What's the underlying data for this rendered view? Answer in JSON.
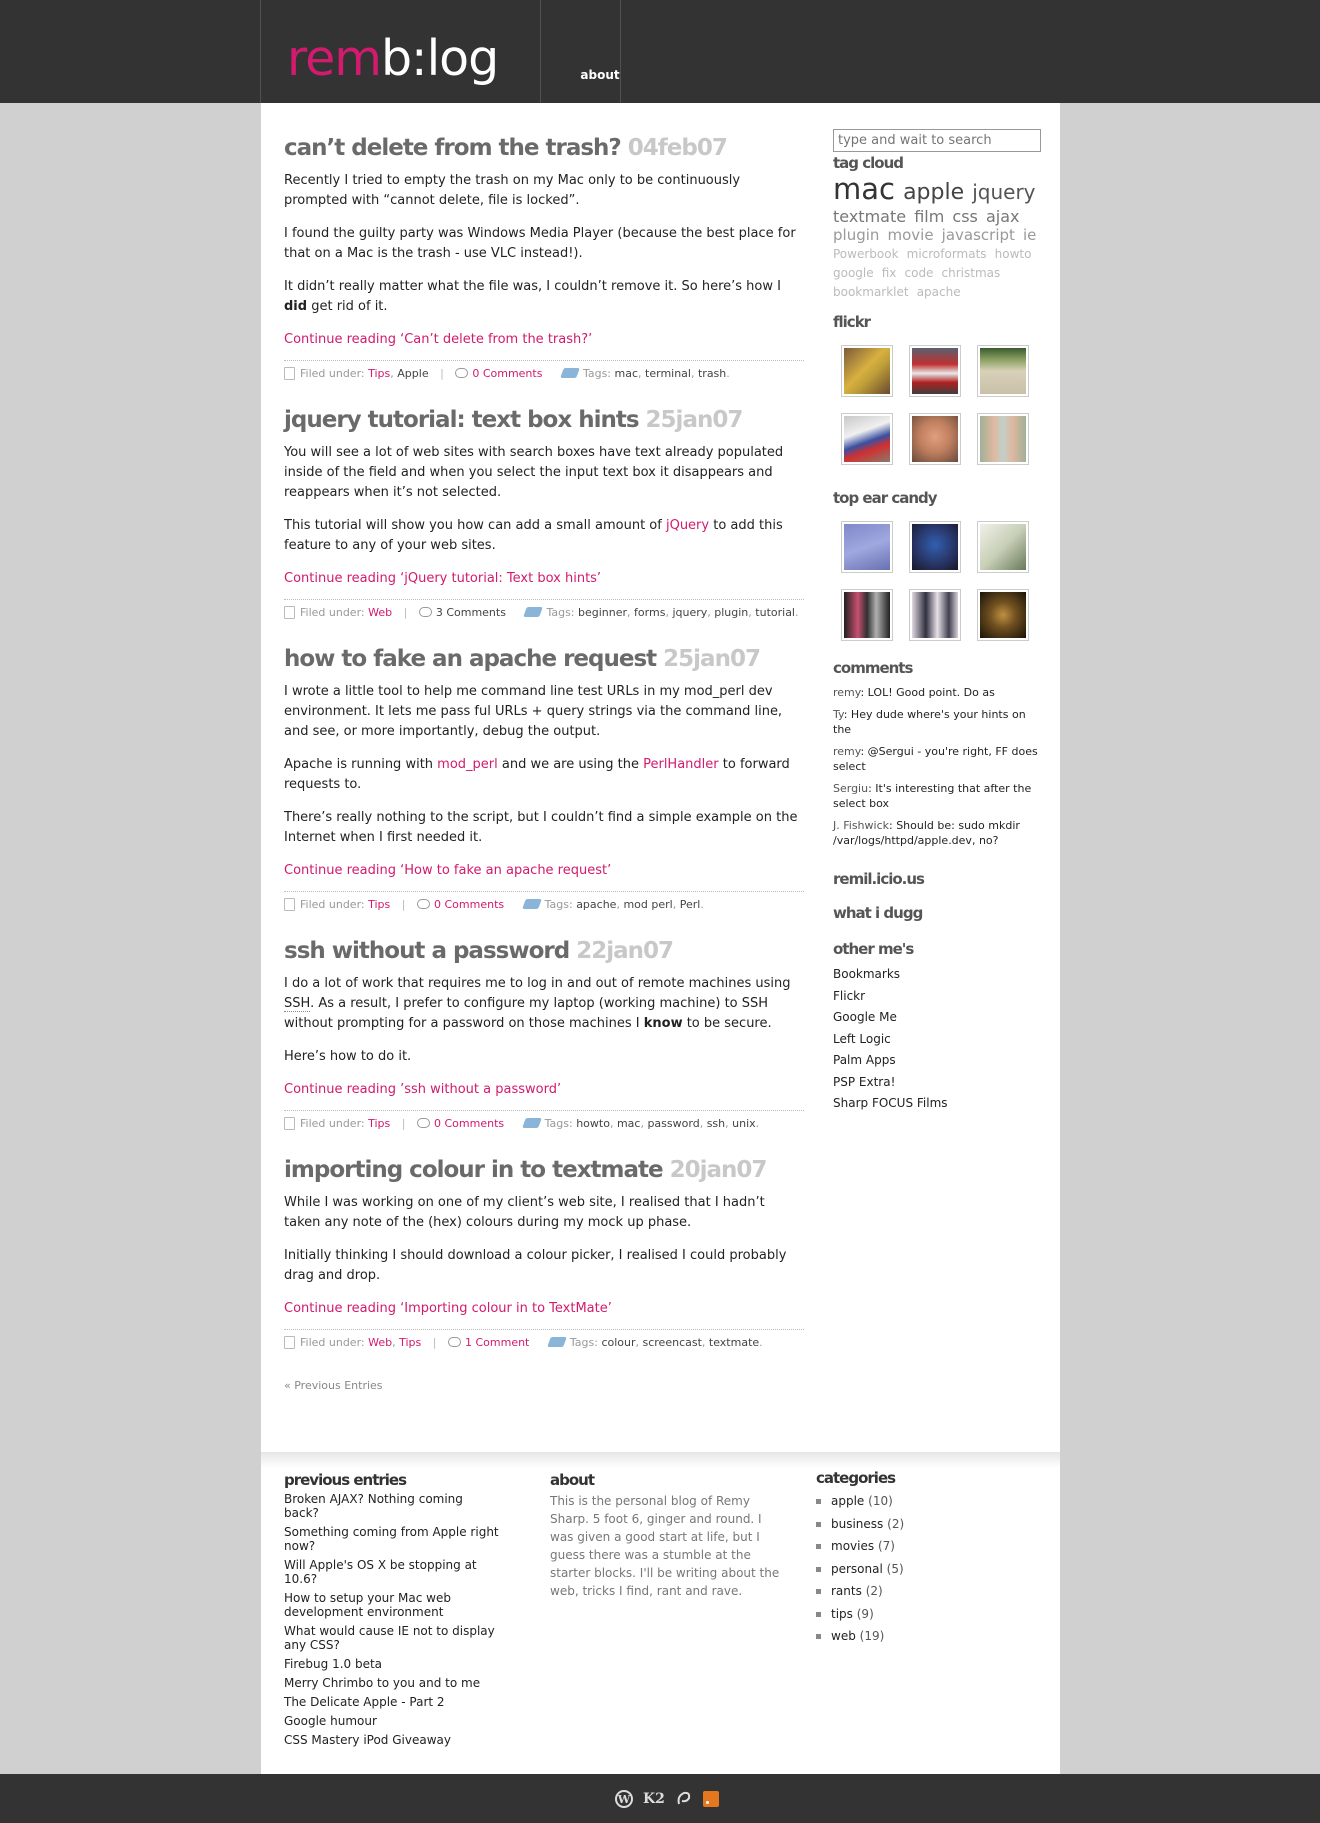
{
  "header": {
    "logo_rem": "rem",
    "logo_blog": "b:log",
    "nav_about": "about"
  },
  "posts": [
    {
      "title": "can’t delete from the trash?",
      "date": "04feb07",
      "paragraphs": [
        "Recently I tried to empty the trash on my Mac only to be continuously prompted with “cannot delete, file is locked”.",
        "I found the guilty party was Windows Media Player (because the best place for that on a Mac is the trash - use VLC instead!)."
      ],
      "p3_a": "It didn’t really matter what the file was, I couldn’t remove it. So here’s how I ",
      "p3_b": "did",
      "p3_c": " get rid of it.",
      "more": "Continue reading ‘Can’t delete from the trash?’",
      "filed_label": "Filed under:",
      "cat1": "Tips",
      "cat2": "Apple",
      "comments": "0 Comments",
      "tags_label": "Tags:",
      "tags": [
        "mac",
        "terminal",
        "trash"
      ]
    },
    {
      "title": "jquery tutorial: text box hints",
      "date": "25jan07",
      "p1": "You will see a lot of web sites with search boxes have text already populated inside of the field and when you select the input text box it disappears and reappears when it’s not selected.",
      "p2_a": "This tutorial will show you how can add a small amount of ",
      "p2_link": "jQuery",
      "p2_b": " to add this feature to any of your web sites.",
      "more": "Continue reading ‘jQuery tutorial: Text box hints’",
      "filed_label": "Filed under:",
      "cat1": "Web",
      "comments": "3 Comments",
      "tags_label": "Tags:",
      "tags": [
        "beginner",
        "forms",
        "jquery",
        "plugin",
        "tutorial"
      ]
    },
    {
      "title": "how to fake an apache request",
      "date": "25jan07",
      "p1": "I wrote a little tool to help me command line test URLs in my mod_perl dev environment. It lets me pass ful URLs + query strings via the command line, and see, or more importantly, debug the output.",
      "p2_a": "Apache is running with ",
      "p2_link1": "mod_perl",
      "p2_b": " and we are using the ",
      "p2_link2": "PerlHandler",
      "p2_c": " to forward requests to.",
      "p3": "There’s really nothing to the script, but I couldn’t find a simple example on the Internet when I first needed it.",
      "more": "Continue reading ‘How to fake an apache request’",
      "filed_label": "Filed under:",
      "cat1": "Tips",
      "comments": "0 Comments",
      "tags_label": "Tags:",
      "tags": [
        "apache",
        "mod perl",
        "Perl"
      ]
    },
    {
      "title": "ssh without a password",
      "date": "22jan07",
      "p1_a": "I do a lot of work that requires me to log in and out of remote machines using ",
      "p1_abbr": "SSH",
      "p1_b": ". As a result, I prefer to configure my laptop (working machine) to SSH without prompting for a password on those machines I ",
      "p1_bold": "know",
      "p1_c": " to be secure.",
      "p2": "Here’s how to do it.",
      "more": "Continue reading ’ssh without a password’",
      "filed_label": "Filed under:",
      "cat1": "Tips",
      "comments": "0 Comments",
      "tags_label": "Tags:",
      "tags": [
        "howto",
        "mac",
        "password",
        "ssh",
        "unix"
      ]
    },
    {
      "title": "importing colour in to textmate",
      "date": "20jan07",
      "p1": "While I was working on one of my client’s web site, I realised that I hadn’t taken any note of the (hex) colours during my mock up phase.",
      "p2": "Initially thinking I should download a colour picker, I realised I could probably drag and drop.",
      "more": "Continue reading ‘Importing colour in to TextMate’",
      "filed_label": "Filed under:",
      "cat1": "Web",
      "cat2": "Tips",
      "comments": "1 Comment",
      "tags_label": "Tags:",
      "tags": [
        "colour",
        "screencast",
        "textmate"
      ]
    }
  ],
  "previous_entries_link": "« Previous Entries",
  "sidebar": {
    "search_placeholder": "type and wait to search",
    "tag_cloud_title": "tag cloud",
    "tags": {
      "mac": "mac",
      "apple": "apple",
      "jquery": "jquery",
      "textmate": "textmate",
      "film": "film",
      "css": "css",
      "ajax": "ajax",
      "plugin": "plugin",
      "movie": "movie",
      "javascript": "javascript",
      "ie": "ie",
      "powerbook": "Powerbook",
      "microformats": "microformats",
      "howto": "howto",
      "google": "google",
      "fix": "fix",
      "code": "code",
      "christmas": "christmas",
      "bookmarklet": "bookmarklet",
      "apache": "apache"
    },
    "flickr_title": "flickr",
    "ear_candy_title": "top ear candy",
    "comments_title": "comments",
    "comments": [
      {
        "who": "remy",
        "text": ": LOL! Good point. Do as"
      },
      {
        "who": "Ty",
        "text": ": Hey dude where's your hints on the"
      },
      {
        "who": "remy",
        "text": ": @Sergui - you're right, FF does select"
      },
      {
        "who": "Sergiu",
        "text": ": It's interesting that after the select box"
      },
      {
        "who": "J. Fishwick",
        "text": ": Should be: sudo mkdir /var/logs/httpd/apple.dev, no?"
      }
    ],
    "remil_title": "remil.icio.us",
    "dugg_title": "what i dugg",
    "other_title": "other me's",
    "other_links": [
      "Bookmarks",
      "Flickr",
      "Google Me",
      "Left Logic",
      "Palm Apps",
      "PSP Extra!",
      "Sharp FOCUS Films"
    ]
  },
  "footer": {
    "prev_title": "previous entries",
    "prev_links": [
      "Broken AJAX? Nothing coming back?",
      "Something coming from Apple right now?",
      "Will Apple's OS X be stopping at 10.6?",
      "How to setup your Mac web development environment",
      "What would cause IE not to display any CSS?",
      "Firebug 1.0 beta",
      "Merry Chrimbo to you and to me",
      "The Delicate Apple - Part 2",
      "Google humour",
      "CSS Mastery iPod Giveaway"
    ],
    "about_title": "about",
    "about_text": "This is the personal blog of Remy Sharp. 5 foot 6, ginger and round. I was given a good start at life, but I guess there was a stumble at the starter blocks. I'll be writing about the web, tricks I find, rant and rave.",
    "cat_title": "categories",
    "categories": [
      {
        "name": "apple",
        "count": "(10)"
      },
      {
        "name": "business",
        "count": "(2)"
      },
      {
        "name": "movies",
        "count": "(7)"
      },
      {
        "name": "personal",
        "count": "(5)"
      },
      {
        "name": "rants",
        "count": "(2)"
      },
      {
        "name": "tips",
        "count": "(9)"
      },
      {
        "name": "web",
        "count": "(19)"
      }
    ]
  },
  "bottom": {
    "k2": "K2"
  },
  "colors": {
    "accent": "#d21a6e",
    "header_bg": "#333333",
    "page_bg": "#d0d0d0"
  }
}
